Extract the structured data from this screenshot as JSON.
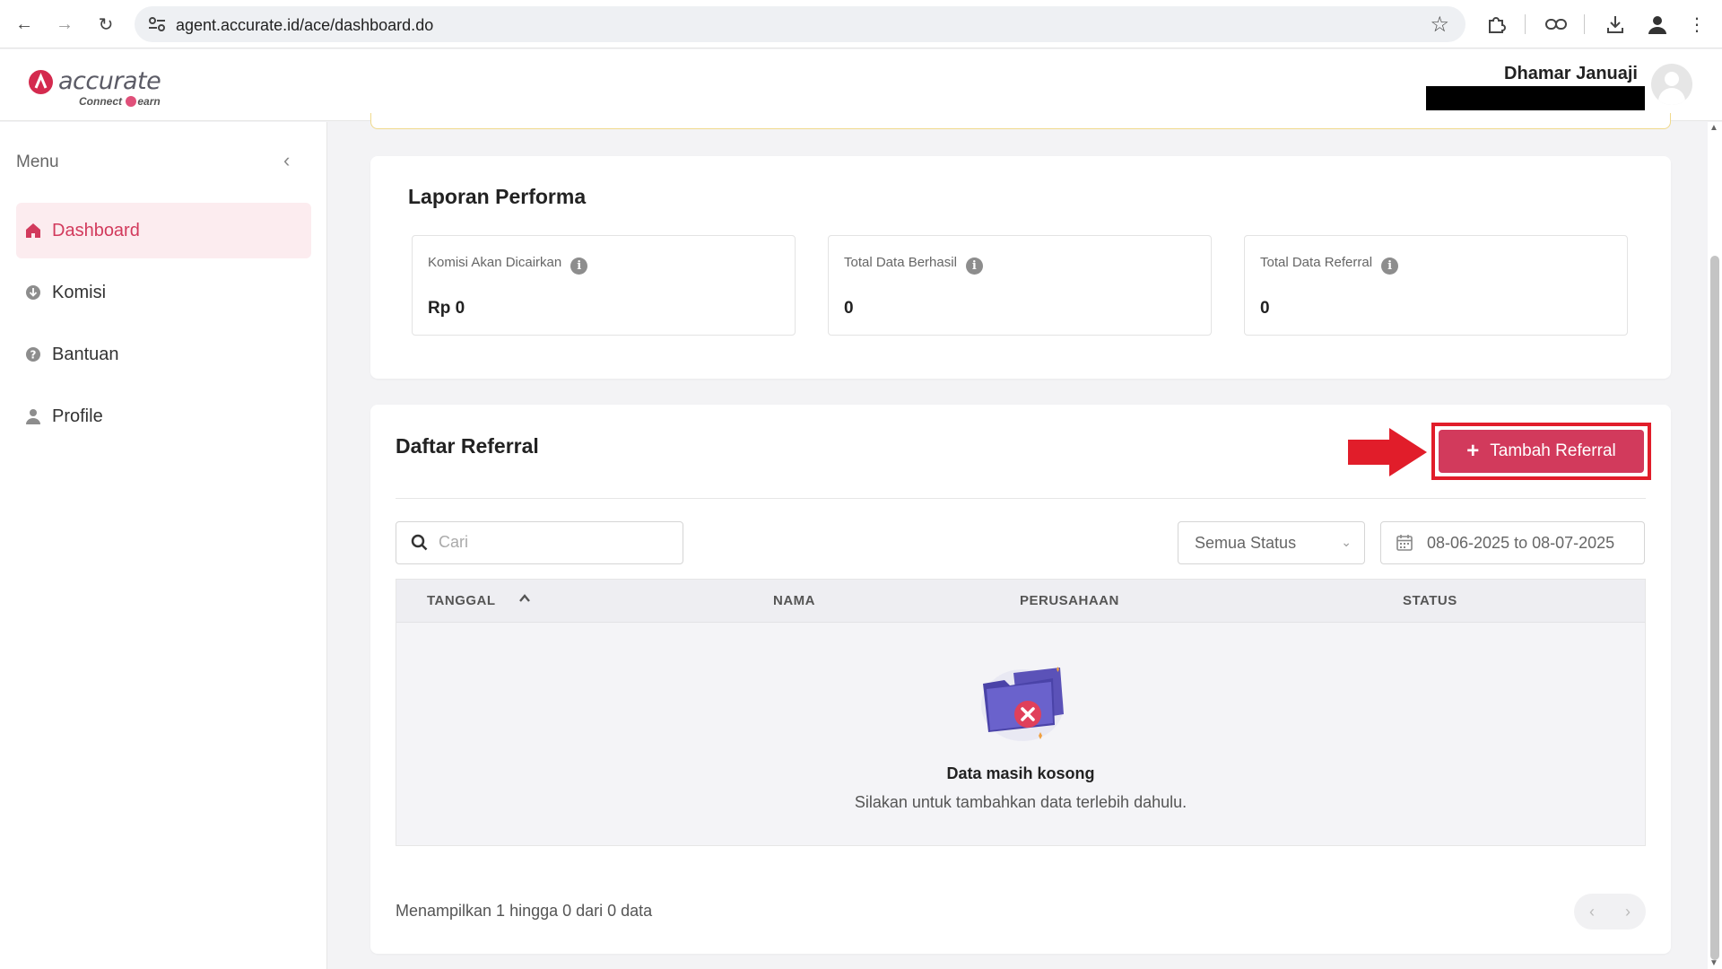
{
  "browser": {
    "url": "agent.accurate.id/ace/dashboard.do"
  },
  "header": {
    "logo_text": "accurate",
    "logo_sub_left": "Connect",
    "logo_sub_right": "earn",
    "user_name": "Dhamar Januaji"
  },
  "sidebar": {
    "title": "Menu",
    "items": [
      {
        "label": "Dashboard",
        "icon": "home-icon",
        "active": true
      },
      {
        "label": "Komisi",
        "icon": "download-circle-icon",
        "active": false
      },
      {
        "label": "Bantuan",
        "icon": "help-circle-icon",
        "active": false
      },
      {
        "label": "Profile",
        "icon": "person-icon",
        "active": false
      }
    ]
  },
  "performance": {
    "title": "Laporan Performa",
    "stats": [
      {
        "label": "Komisi Akan Dicairkan",
        "value": "Rp 0"
      },
      {
        "label": "Total Data Berhasil",
        "value": "0"
      },
      {
        "label": "Total Data Referral",
        "value": "0"
      }
    ]
  },
  "referral": {
    "title": "Daftar Referral",
    "add_button": "Tambah Referral",
    "search_placeholder": "Cari",
    "status_filter": "Semua Status",
    "date_range": "08-06-2025 to 08-07-2025",
    "columns": [
      "TANGGAL",
      "NAMA",
      "PERUSAHAAN",
      "STATUS"
    ],
    "rows": [],
    "empty_title": "Data masih kosong",
    "empty_subtitle": "Silakan untuk tambahkan data terlebih dahulu.",
    "footer": "Menampilkan 1 hingga 0 dari 0 data"
  },
  "colors": {
    "accent": "#d23a5c",
    "annotation": "#e11d2a"
  }
}
